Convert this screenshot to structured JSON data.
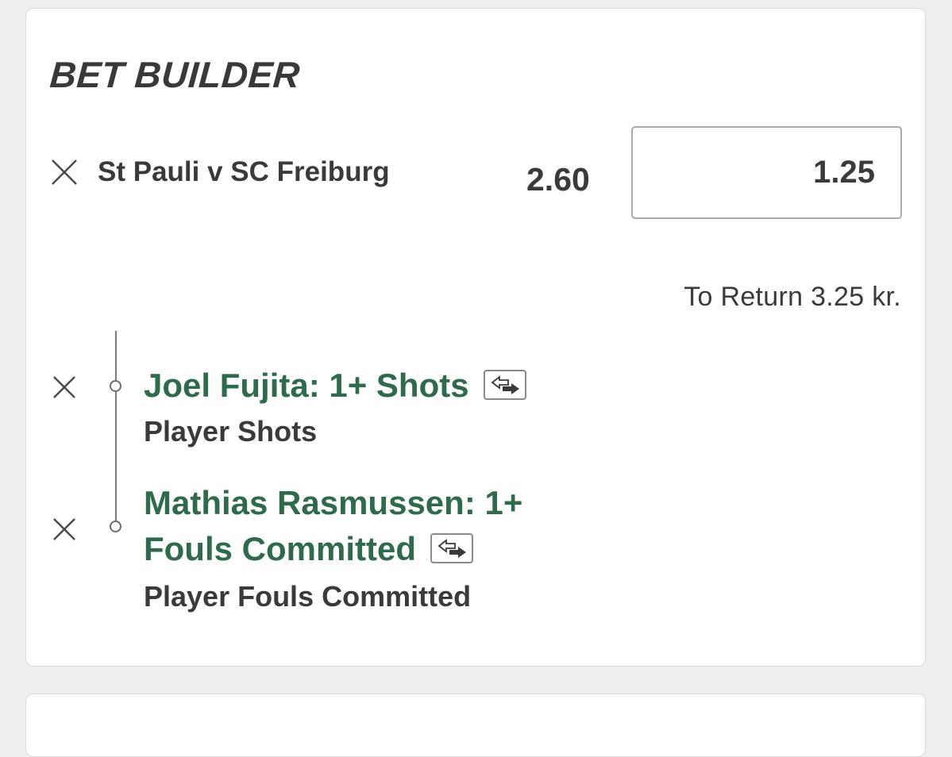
{
  "bet_builder": {
    "title": "BET BUILDER",
    "match": {
      "name": "St Pauli v SC Freiburg",
      "odds": "2.60",
      "stake": "1.25"
    },
    "to_return": "To Return 3.25 kr.",
    "selections": [
      {
        "title": "Joel Fujita: 1+ Shots",
        "market": "Player Shots"
      },
      {
        "title_line1": "Mathias Rasmussen: 1+",
        "title_line2": "Fouls Committed",
        "market": "Player Fouls Committed"
      }
    ]
  },
  "colors": {
    "selection_green": "#2e6b4c",
    "text_dark": "#3a3a3a",
    "background": "#efefef"
  },
  "icons": {
    "remove": "close-icon",
    "swap": "swap-icon"
  }
}
